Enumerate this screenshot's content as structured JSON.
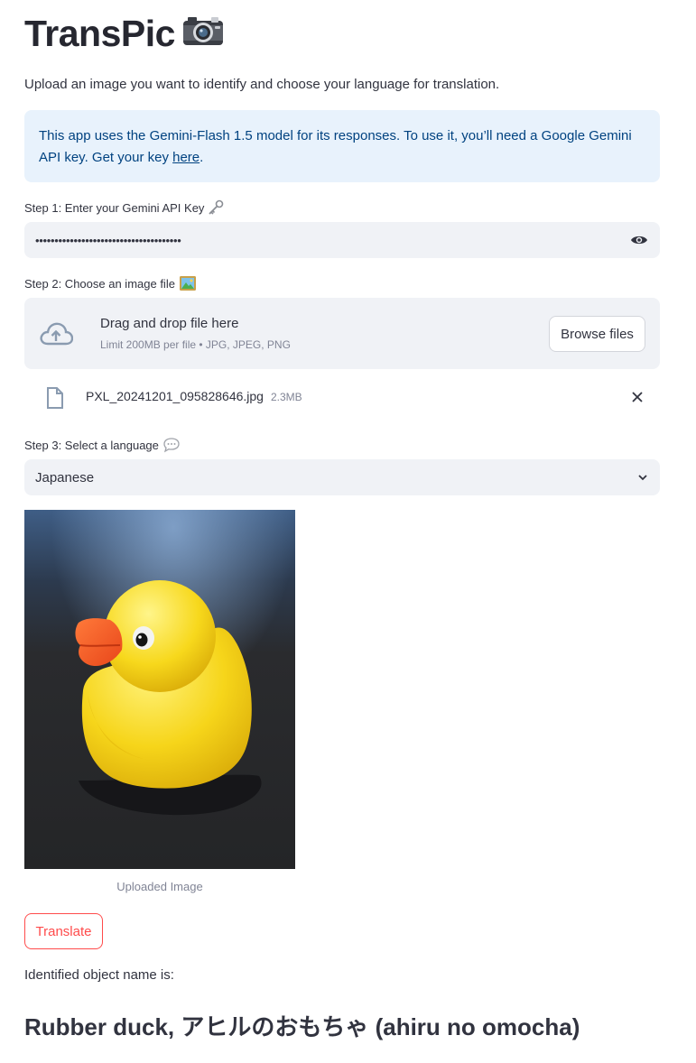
{
  "header": {
    "title": "TransPic",
    "subtitle": "Upload an image you want to identify and choose your language for translation."
  },
  "info": {
    "text": "This app uses the Gemini-Flash 1.5 model for its responses. To use it, you’ll need a Google Gemini API key. Get your key ",
    "link": "here",
    "end": "."
  },
  "step1": {
    "label": "Step 1: Enter your Gemini API Key",
    "value": "••••••••••••••••••••••••••••••••••••••"
  },
  "step2": {
    "label": "Step 2: Choose an image file",
    "drop_title": "Drag and drop file here",
    "drop_limit": "Limit 200MB per file • JPG, JPEG, PNG",
    "browse": "Browse files",
    "file_name": "PXL_20241201_095828646.jpg",
    "file_size": "2.3MB"
  },
  "step3": {
    "label": "Step 3: Select a language",
    "selected": "Japanese"
  },
  "image": {
    "caption": "Uploaded Image"
  },
  "action": {
    "translate": "Translate"
  },
  "result": {
    "label": "Identified object name is:",
    "value": "Rubber duck, アヒルのおもちゃ (ahiru no omocha)"
  },
  "colors": {
    "primary": "#ff4b4b",
    "info_bg": "#e8f2fc",
    "info_text": "#004280",
    "input_bg": "#f0f2f6"
  },
  "icons": [
    "camera-icon",
    "key-icon",
    "framed-picture-icon",
    "speech-bubble-icon",
    "eye-icon",
    "cloud-upload-icon",
    "file-icon",
    "close-icon",
    "chevron-down-icon"
  ]
}
